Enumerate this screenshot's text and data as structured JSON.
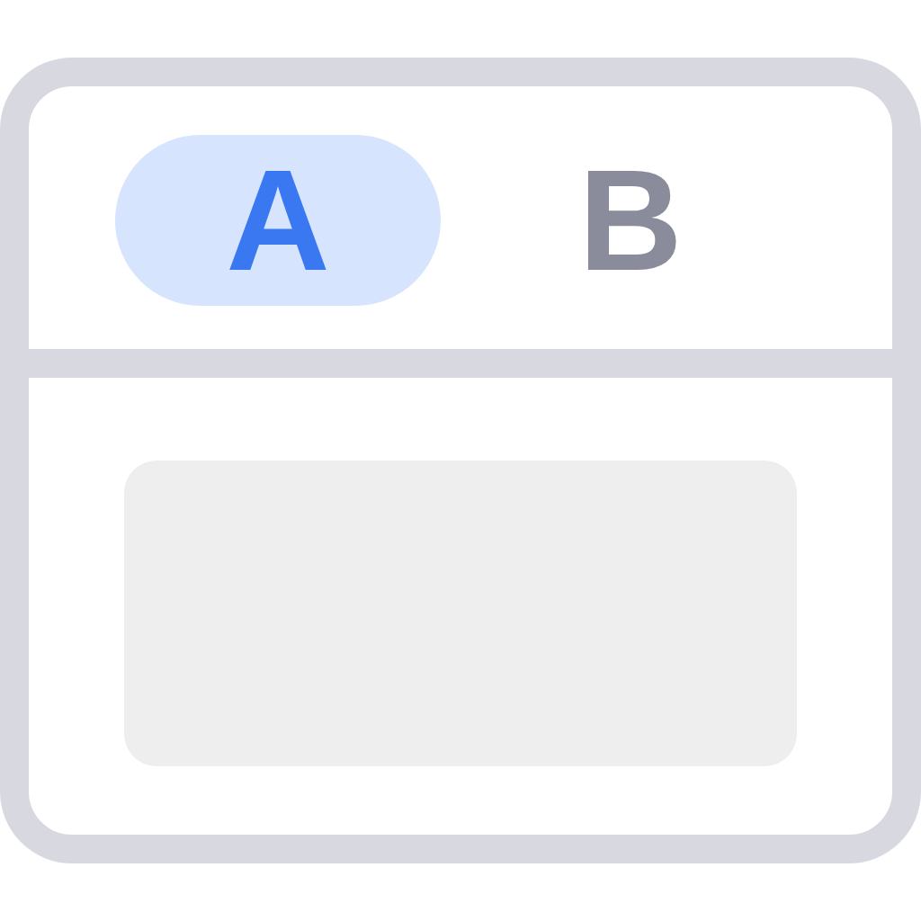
{
  "tabs": [
    {
      "label": "A",
      "selected": true
    },
    {
      "label": "B",
      "selected": false
    }
  ]
}
